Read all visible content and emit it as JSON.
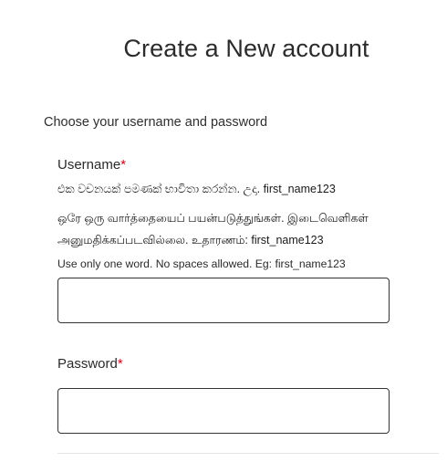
{
  "title": "Create a New account",
  "section_label": "Choose your username and password",
  "username": {
    "label": "Username",
    "required_mark": "*",
    "help_sinhala": "එක වචනයක් පමණක් භාවිතා කරන්න. උදා. first_name123",
    "help_tamil_line1": "ஒரே ஒரு வார்த்தையைப் பயன்படுத்துங்கள். இடைவெளிகள்",
    "help_tamil_line2": "அனுமதிக்கப்படவில்லை. உதாரணம்: first_name123",
    "help_english": "Use only one word. No spaces allowed. Eg: first_name123",
    "value": ""
  },
  "password": {
    "label": "Password",
    "required_mark": "*",
    "value": ""
  }
}
